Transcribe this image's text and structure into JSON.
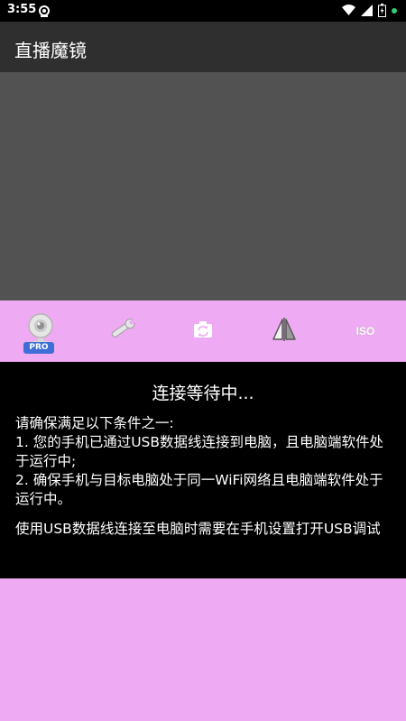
{
  "status_bar": {
    "time": "3:55",
    "icons": [
      "notification-icon",
      "wifi-icon",
      "signal-icon",
      "battery-icon",
      "dot-icon"
    ]
  },
  "app": {
    "title": "直播魔镜"
  },
  "toolbar": {
    "items": [
      {
        "icon": "webcam-icon",
        "badge": "PRO"
      },
      {
        "icon": "wrench-icon"
      },
      {
        "icon": "camera-switch-icon"
      },
      {
        "icon": "mirror-flip-icon"
      },
      {
        "icon": "iso-icon",
        "label": "ISO"
      }
    ]
  },
  "panel": {
    "status": "连接等待中...",
    "intro": "请确保满足以下条件之一:",
    "condition_1": "1. 您的手机已通过USB数据线连接到电脑，且电脑端软件处于运行中;",
    "condition_2": "2. 确保手机与目标电脑处于同一WiFi网络且电脑端软件处于运行中。",
    "note": "使用USB数据线连接至电脑时需要在手机设置打开USB调试"
  },
  "colors": {
    "status_bar": "#000000",
    "app_bar": "#2f2f2f",
    "preview": "#525252",
    "toolbar_bg": "#eeaaf2",
    "panel_bg": "#000000",
    "pro_badge": "#3d6fd6",
    "status_dot": "#2ecc71"
  }
}
